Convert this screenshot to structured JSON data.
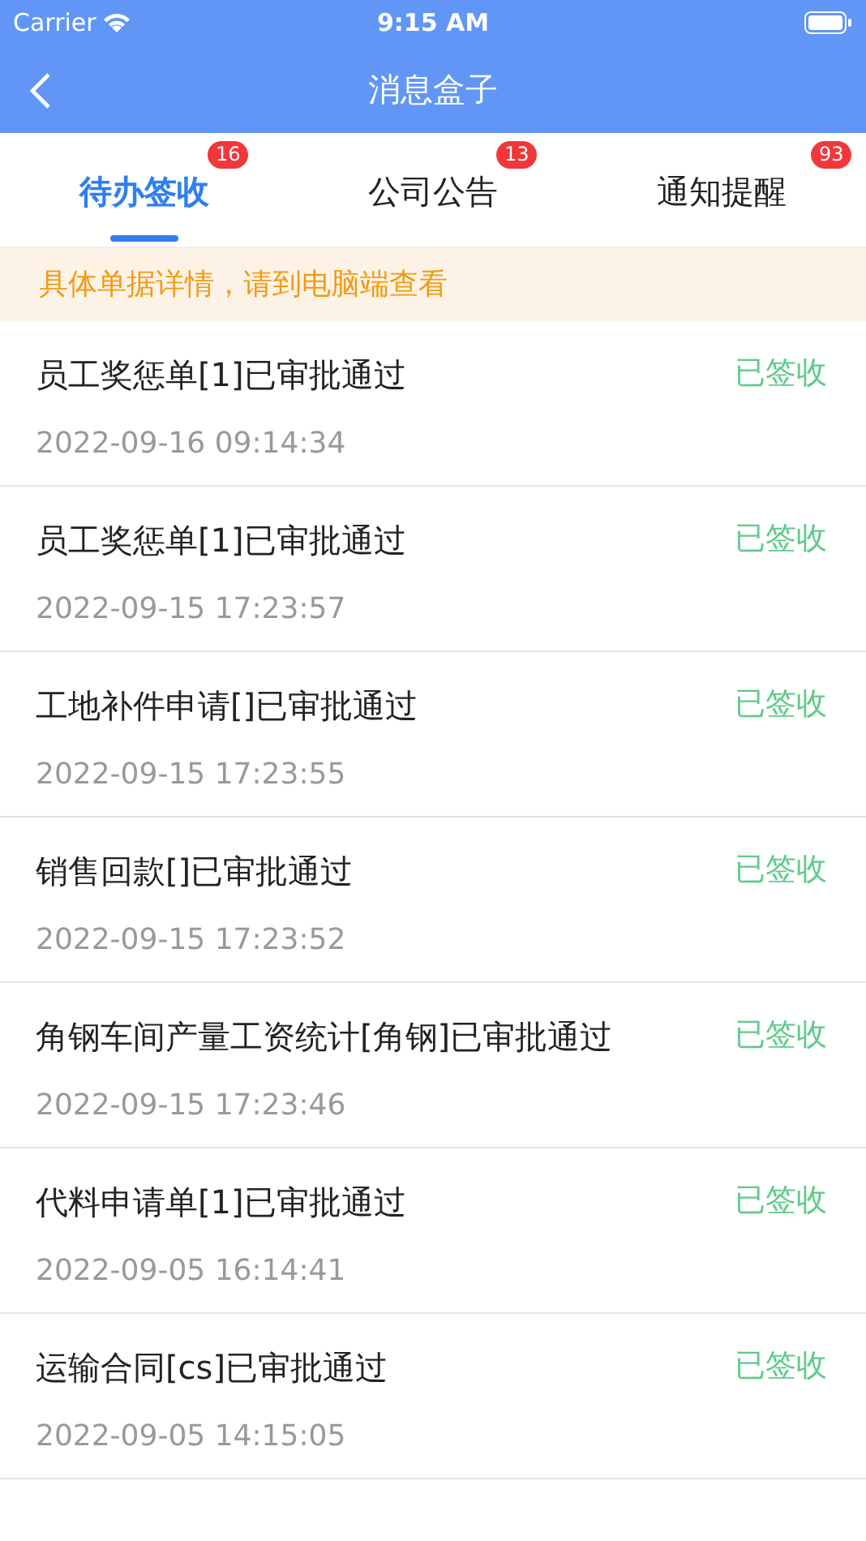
{
  "status_bar": {
    "carrier": "Carrier",
    "time": "9:15 AM"
  },
  "nav": {
    "title": "消息盒子"
  },
  "tabs": [
    {
      "label": "待办签收",
      "badge": "16",
      "selected": true
    },
    {
      "label": "公司公告",
      "badge": "13",
      "selected": false
    },
    {
      "label": "通知提醒",
      "badge": "93",
      "selected": false
    }
  ],
  "notice": "具体单据详情，请到电脑端查看",
  "messages": [
    {
      "title": "员工奖惩单[1]已审批通过",
      "time": "2022-09-16 09:14:34",
      "status": "已签收"
    },
    {
      "title": "员工奖惩单[1]已审批通过",
      "time": "2022-09-15 17:23:57",
      "status": "已签收"
    },
    {
      "title": "工地补件申请[]已审批通过",
      "time": "2022-09-15 17:23:55",
      "status": "已签收"
    },
    {
      "title": "销售回款[]已审批通过",
      "time": "2022-09-15 17:23:52",
      "status": "已签收"
    },
    {
      "title": "角钢车间产量工资统计[角钢]已审批通过",
      "time": "2022-09-15 17:23:46",
      "status": "已签收"
    },
    {
      "title": "代料申请单[1]已审批通过",
      "time": "2022-09-05 16:14:41",
      "status": "已签收"
    },
    {
      "title": "运输合同[cs]已审批通过",
      "time": "2022-09-05 14:15:05",
      "status": "已签收"
    }
  ]
}
